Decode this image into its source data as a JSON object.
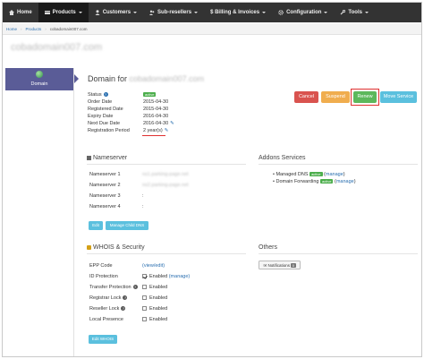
{
  "nav": {
    "items": [
      {
        "label": "Home",
        "icon": "home-icon",
        "active": false,
        "caret": false
      },
      {
        "label": "Products",
        "icon": "products-icon",
        "active": true,
        "caret": true
      },
      {
        "label": "Customers",
        "icon": "customers-icon",
        "active": false,
        "caret": true
      },
      {
        "label": "Sub-resellers",
        "icon": "sub-resellers-icon",
        "active": false,
        "caret": true
      },
      {
        "label": "$ Billing & Invoices",
        "icon": "",
        "active": false,
        "caret": true
      },
      {
        "label": "Configuration",
        "icon": "gear-icon",
        "active": false,
        "caret": true
      },
      {
        "label": "Tools",
        "icon": "wrench-icon",
        "active": false,
        "caret": true
      }
    ]
  },
  "breadcrumb": {
    "home": "Home",
    "products": "Products",
    "current": "cobadomain007.com"
  },
  "page_title": "cobadomain007.com",
  "side_tab": {
    "label": "Domain"
  },
  "domain": {
    "heading_prefix": "Domain for",
    "heading_domain": "cobadomain007.com",
    "status_label": "Status",
    "status_badge": "active",
    "order_date_label": "Order Date",
    "order_date": "2015-04-30",
    "registered_label": "Registered Date",
    "registered": "2015-04-30",
    "expiry_label": "Expiry Date",
    "expiry": "2016-04-30",
    "next_due_label": "Next Due Date",
    "next_due": "2016-04-30",
    "period_label": "Registration Period",
    "period": "2 year(s)"
  },
  "actions": {
    "cancel": "Cancel",
    "suspend": "Suspend",
    "renew": "Renew",
    "move": "Move Service"
  },
  "nameserver": {
    "title": "Nameserver",
    "rows": [
      {
        "label": "Nameserver 1",
        "value": "ns1.parking-page.net"
      },
      {
        "label": "Nameserver 2",
        "value": "ns2.parking-page.net"
      },
      {
        "label": "Nameserver 3",
        "value": ":"
      },
      {
        "label": "Nameserver 4",
        "value": ":"
      }
    ],
    "edit": "Edit",
    "manage_child": "Manage Child DNS"
  },
  "addons": {
    "title": "Addons Services",
    "managed_dns": "Managed DNS",
    "domain_forwarding": "Domain Forwarding",
    "badge": "active",
    "manage_link": "manage"
  },
  "whois": {
    "title": "WHOIS & Security",
    "epp_label": "EPP Code",
    "epp_value": "(view/edit)",
    "rows": [
      {
        "label": "ID Protection",
        "checked": true,
        "status": "Enabled",
        "link": "(manage)",
        "help": false
      },
      {
        "label": "Transfer Protection",
        "checked": false,
        "status": "Enabled",
        "link": "",
        "help": true
      },
      {
        "label": "Registrar Lock",
        "checked": false,
        "status": "Enabled",
        "link": "",
        "help": true
      },
      {
        "label": "Reseller Lock",
        "checked": false,
        "status": "Enabled",
        "link": "",
        "help": true
      },
      {
        "label": "Local Presence",
        "checked": false,
        "status": "Enabled",
        "link": "",
        "help": false
      }
    ],
    "edit": "Edit WHOIS"
  },
  "others": {
    "title": "Others",
    "notifications": "Notifications",
    "notifications_count": "0"
  }
}
